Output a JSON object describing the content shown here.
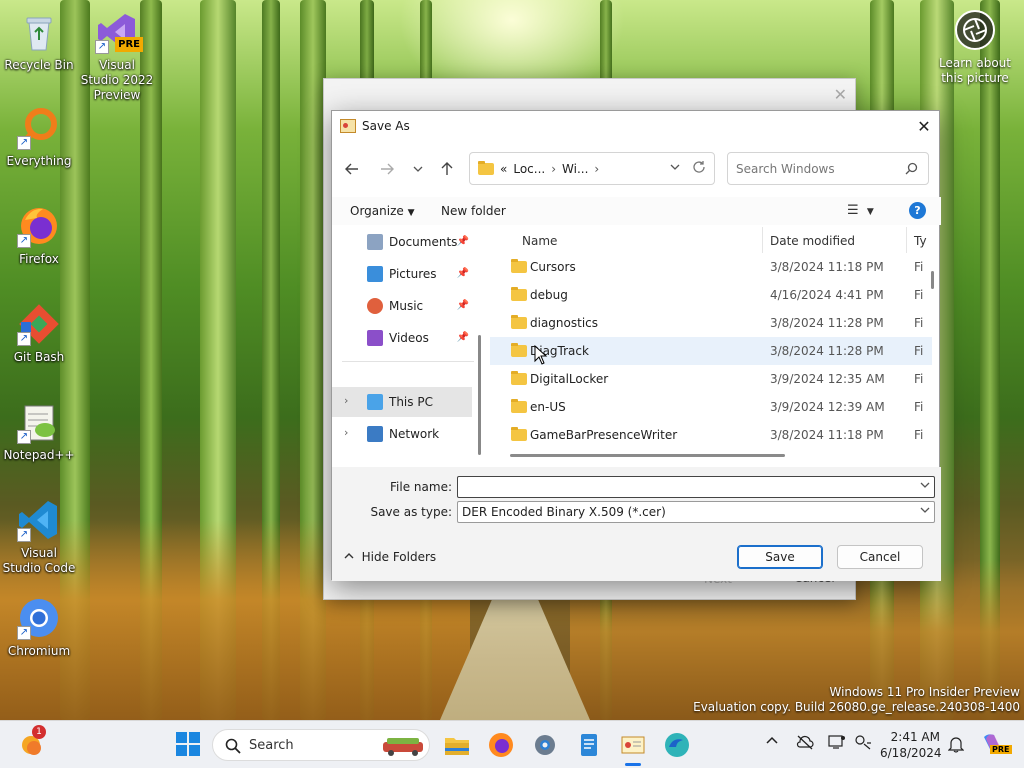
{
  "desktop": {
    "icons": [
      {
        "label": "Recycle Bin"
      },
      {
        "label": "Visual Studio 2022 Preview",
        "badge": "PRE"
      },
      {
        "label": "Everything"
      },
      {
        "label": "Firefox"
      },
      {
        "label": "Git Bash"
      },
      {
        "label": "Notepad++"
      },
      {
        "label": "Visual Studio Code"
      },
      {
        "label": "Chromium"
      }
    ],
    "learn_label": "Learn about this picture",
    "watermark_line1": "Windows 11 Pro Insider Preview",
    "watermark_line2": "Evaluation copy. Build 26080.ge_release.240308-1400"
  },
  "background_window": {
    "next_label": "Next",
    "cancel_label": "Cancel"
  },
  "dialog": {
    "title": "Save As",
    "address": {
      "overflow": "«",
      "segment1": "Loc...",
      "segment2": "Wi..."
    },
    "search_placeholder": "Search Windows",
    "toolbar": {
      "organize_label": "Organize",
      "new_folder_label": "New folder"
    },
    "nav_items": [
      {
        "label": "Documents"
      },
      {
        "label": "Pictures"
      },
      {
        "label": "Music"
      },
      {
        "label": "Videos"
      },
      {
        "label": "This PC"
      },
      {
        "label": "Network"
      }
    ],
    "columns": {
      "name": "Name",
      "date": "Date modified",
      "type": "Ty"
    },
    "files": [
      {
        "name": "Cursors",
        "date": "3/8/2024 11:18 PM",
        "type": "Fi"
      },
      {
        "name": "debug",
        "date": "4/16/2024 4:41 PM",
        "type": "Fi"
      },
      {
        "name": "diagnostics",
        "date": "3/8/2024 11:28 PM",
        "type": "Fi"
      },
      {
        "name": "DiagTrack",
        "date": "3/8/2024 11:28 PM",
        "type": "Fi"
      },
      {
        "name": "DigitalLocker",
        "date": "3/9/2024 12:35 AM",
        "type": "Fi"
      },
      {
        "name": "en-US",
        "date": "3/9/2024 12:39 AM",
        "type": "Fi"
      },
      {
        "name": "GameBarPresenceWriter",
        "date": "3/8/2024 11:18 PM",
        "type": "Fi"
      }
    ],
    "file_name_label": "File name:",
    "file_name_value": "",
    "save_type_label": "Save as type:",
    "save_type_value": "DER Encoded Binary X.509 (*.cer)",
    "hide_folders_label": "Hide Folders",
    "save_label": "Save",
    "cancel_label": "Cancel"
  },
  "taskbar": {
    "search_label": "Search",
    "notification_count": "1",
    "time": "2:41 AM",
    "date": "6/18/2024",
    "copilot_badge": "PRE"
  },
  "colors": {
    "accent": "#1b6fcb",
    "folder": "#f4c542",
    "hover_row": "#e8f1fb"
  }
}
